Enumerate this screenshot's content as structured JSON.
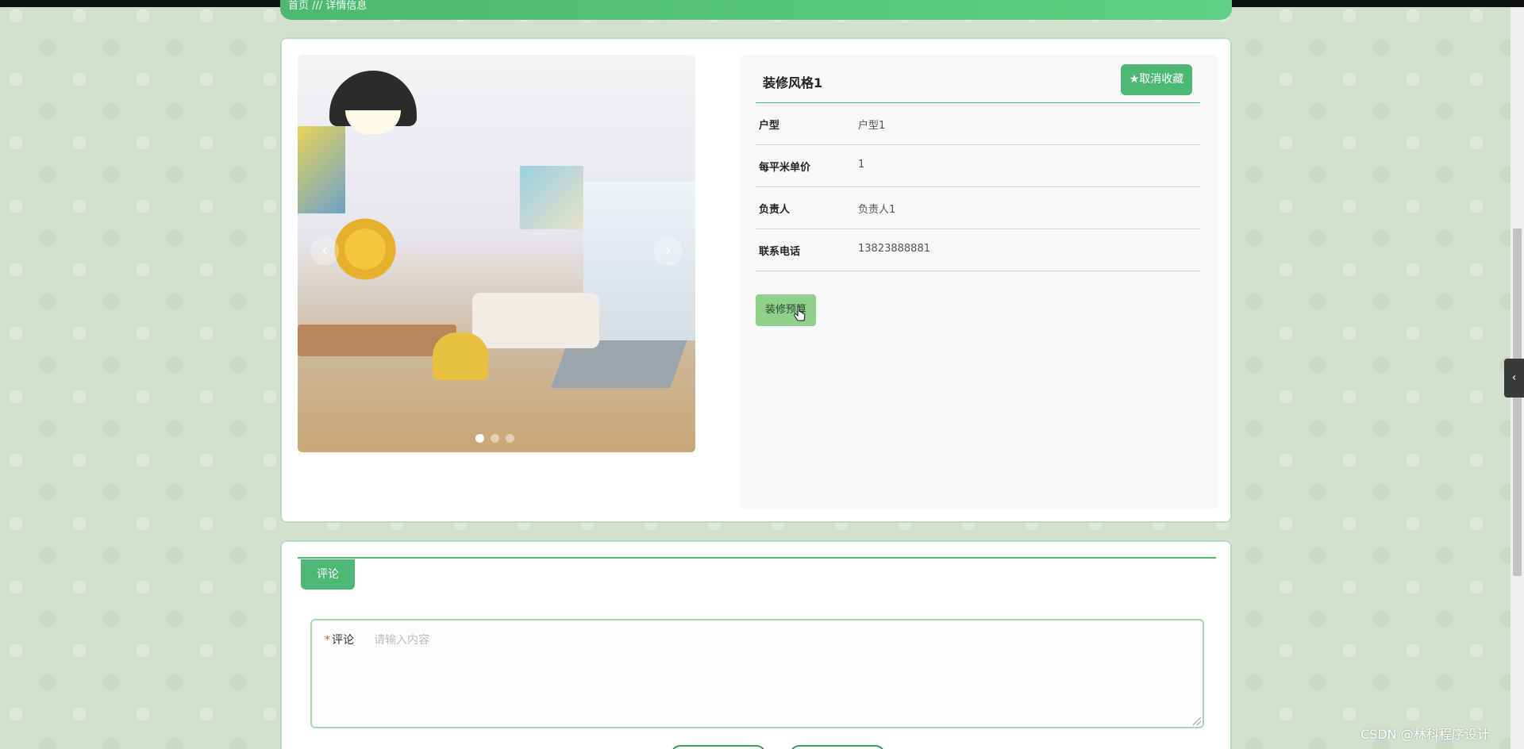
{
  "breadcrumb": {
    "text": "首页 /// 详情信息"
  },
  "detail": {
    "title": "装修风格1",
    "favorite_button": "★取消收藏",
    "fields": [
      {
        "label": "户型",
        "value": "户型1"
      },
      {
        "label": "每平米单价",
        "value": "1"
      },
      {
        "label": "负责人",
        "value": "负责人1"
      },
      {
        "label": "联系电话",
        "value": "13823888881"
      }
    ],
    "budget_button": "装修预算",
    "carousel": {
      "prev": "‹",
      "next": "›",
      "slide_count": 3,
      "active_index": 0
    }
  },
  "comments": {
    "tab_label": "评论",
    "form_label": "评论",
    "required_mark": "*",
    "placeholder": "请输入内容"
  },
  "sidebar_toggle": {
    "glyph": "‹"
  },
  "watermark": "CSDN @林科程序设计",
  "colors": {
    "accent": "#4cb874",
    "accent_light": "#8fd08c",
    "page_bg": "#d4e0cd"
  }
}
